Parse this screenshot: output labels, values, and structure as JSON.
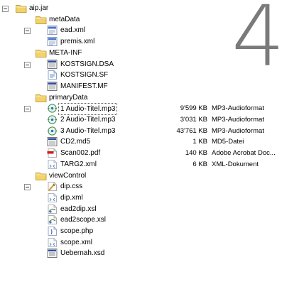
{
  "page_number": "4",
  "tree": [
    {
      "label": "aip.jar",
      "icon": "folder-icon",
      "depth": 0,
      "expand": true
    },
    {
      "label": "metaData",
      "icon": "folder-icon",
      "depth": 1,
      "expand": false
    },
    {
      "label": "ead.xml",
      "icon": "xml-file-icon",
      "depth": 2,
      "expand": true
    },
    {
      "label": "premis.xml",
      "icon": "xml-file-icon",
      "depth": 2,
      "expand": false
    },
    {
      "label": "META-INF",
      "icon": "folder-icon",
      "depth": 1,
      "expand": false
    },
    {
      "label": "KOSTSIGN.DSA",
      "icon": "generic-file-icon",
      "depth": 2,
      "expand": true
    },
    {
      "label": "KOSTSIGN.SF",
      "icon": "text-file-icon",
      "depth": 2,
      "expand": false
    },
    {
      "label": "MANIFEST.MF",
      "icon": "generic-file-icon",
      "depth": 2,
      "expand": false
    },
    {
      "label": "primaryData",
      "icon": "folder-icon",
      "depth": 1,
      "expand": false
    },
    {
      "label": "1 Audio-Titel.mp3",
      "icon": "audio-file-icon",
      "depth": 2,
      "expand": true,
      "selected": true,
      "size": "9'599 KB",
      "type": "MP3-Audioformat"
    },
    {
      "label": "2 Audio-Titel.mp3",
      "icon": "audio-file-icon",
      "depth": 2,
      "expand": false,
      "size": "3'031 KB",
      "type": "MP3-Audioformat"
    },
    {
      "label": "3 Audio-Titel.mp3",
      "icon": "audio-file-icon",
      "depth": 2,
      "expand": false,
      "size": "43'761 KB",
      "type": "MP3-Audioformat"
    },
    {
      "label": "CD2.md5",
      "icon": "generic-file-icon",
      "depth": 2,
      "expand": false,
      "size": "1 KB",
      "type": "MD5-Datei"
    },
    {
      "label": "Scan002.pdf",
      "icon": "pdf-file-icon",
      "depth": 2,
      "expand": false,
      "size": "140 KB",
      "type": "Adobe Acrobat Doc..."
    },
    {
      "label": "TARG2.xml",
      "icon": "xml-doc-icon",
      "depth": 2,
      "expand": false,
      "size": "6 KB",
      "type": "XML-Dokument"
    },
    {
      "label": "viewControl",
      "icon": "folder-icon",
      "depth": 1,
      "expand": false
    },
    {
      "label": "dip.css",
      "icon": "css-file-icon",
      "depth": 2,
      "expand": true
    },
    {
      "label": "dip.xml",
      "icon": "xml-doc-icon",
      "depth": 2,
      "expand": false
    },
    {
      "label": "ead2dip.xsl",
      "icon": "xsl-file-icon",
      "depth": 2,
      "expand": false
    },
    {
      "label": "ead2scope.xsl",
      "icon": "xsl-file-icon",
      "depth": 2,
      "expand": false
    },
    {
      "label": "scope.php",
      "icon": "php-file-icon",
      "depth": 2,
      "expand": false
    },
    {
      "label": "scope.xml",
      "icon": "xml-doc-icon",
      "depth": 2,
      "expand": false
    },
    {
      "label": "Uebernah.xsd",
      "icon": "xsd-file-icon",
      "depth": 2,
      "expand": false
    }
  ],
  "colors": {
    "folder": "#f2d36a",
    "folder_edge": "#b58d22",
    "link_blue": "#1f5fbf",
    "pdf_red": "#cc1e1e",
    "selection_border": "#555555"
  }
}
